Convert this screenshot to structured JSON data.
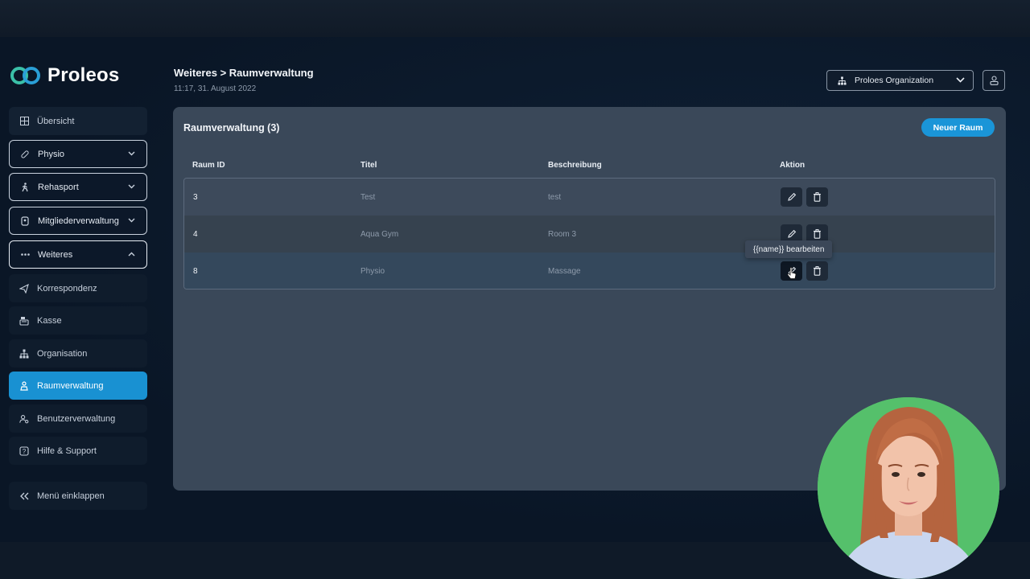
{
  "app": {
    "name": "Proleos"
  },
  "sidebar": {
    "items": [
      {
        "label": "Übersicht",
        "icon": "grid-icon"
      },
      {
        "label": "Physio",
        "icon": "bandage-icon"
      },
      {
        "label": "Rehasport",
        "icon": "walking-icon"
      },
      {
        "label": "Mitgliederverwaltung",
        "icon": "card-icon"
      },
      {
        "label": "Weiteres",
        "icon": "ellipsis-icon"
      },
      {
        "label": "Korrespondenz",
        "icon": "paper-plane-icon"
      },
      {
        "label": "Kasse",
        "icon": "cash-register-icon"
      },
      {
        "label": "Organisation",
        "icon": "sitemap-icon"
      },
      {
        "label": "Raumverwaltung",
        "icon": "room-icon"
      },
      {
        "label": "Benutzerverwaltung",
        "icon": "user-gear-icon"
      },
      {
        "label": "Hilfe & Support",
        "icon": "help-icon"
      }
    ],
    "collapse_label": "Menü einklappen"
  },
  "header": {
    "breadcrumb": "Weiteres > Raumverwaltung",
    "timestamp": "11:17, 31. August 2022",
    "org_select": "Proloes Organization"
  },
  "panel": {
    "title": "Raumverwaltung (3)",
    "new_button": "Neuer Raum",
    "columns": [
      "Raum ID",
      "Titel",
      "Beschreibung",
      "Aktion"
    ],
    "rows": [
      {
        "id": "3",
        "title": "Test",
        "description": "test"
      },
      {
        "id": "4",
        "title": "Aqua Gym",
        "description": "Room 3"
      },
      {
        "id": "8",
        "title": "Physio",
        "description": "Massage"
      }
    ]
  },
  "tooltip": "{{name}} bearbeiten",
  "colors": {
    "accent": "#1a95d8",
    "background": "#0a1626",
    "panel": "#3a4859",
    "webcam_bg": "#55c06b"
  }
}
